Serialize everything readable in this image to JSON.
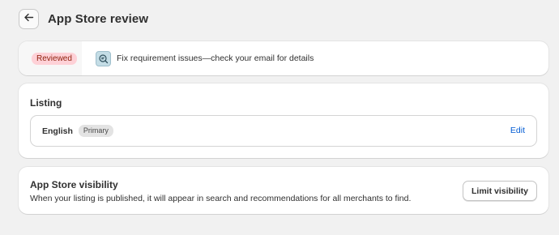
{
  "header": {
    "title": "App Store review",
    "back_icon": "arrow-left-icon"
  },
  "review": {
    "status": "Reviewed",
    "status_color": "#fed1d7",
    "icon": "search-list-icon",
    "message": "Fix requirement issues—check your email for details"
  },
  "listing": {
    "title": "Listing",
    "language": "English",
    "language_badge": "Primary",
    "edit_label": "Edit",
    "edit_color": "#005bd3"
  },
  "visibility": {
    "title": "App Store visibility",
    "description": "When your listing is published, it will appear in search and recommendations for all merchants to find.",
    "button_label": "Limit visibility"
  }
}
